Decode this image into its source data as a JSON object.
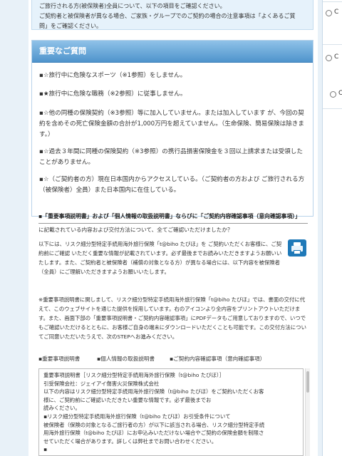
{
  "top_notice": {
    "lines": [
      "ご旅行される方(被保険者)全員について、以下の項目をご確認ください。",
      "ご契約者と被保険者が異なる場合、ご家族・グループでのご契約の場合の注意事項は「よくあるご質",
      "問」をご確認ください。"
    ]
  },
  "faq": {
    "title": "重要なご質問",
    "items": [
      "▪☆旅行中に危険なスポーツ（※1参照）をしません。",
      "▪★旅行中に危険な職務（※2参照）に従事しません。",
      "▪☆他の同種の保険契約（※3参照）等に加入していません。または加入しています が、今回の契約を含めその死亡保険金額の合計が1,000万円を超えていません。（生命保険、簡易保険は除きます。）",
      "▪☆過去３年間に同種の保険契約（※3参照）の携行品損害保険金を３回以上請求または受領したことがありません。",
      "▪☆（ご契約者の方）現在日本国内からアクセスしている。（ご契約者の方および ご旅行される方（被保険者）全員）また日本国内に在住している。"
    ]
  },
  "documents": {
    "heading": "▪「重要事項説明書」および「個人情報の取扱説明書」ならびに「ご契約内容確認事項（意向確認事項）」",
    "subheading": "に記載されている内容および交付方法について、全てご確認いただけましたか？",
    "paragraph1": "以下には、リスク細分型特定手続用海外旅行保険「t@biho たびほ」を ご契約いただくお客様に、ご契約前にご確認 いただく重要な情報が記載されています。必ず最後までお読みいただきますようお願いいたします。また、ご契約者と被保険者（補償の対象となる方）が異なる場合には、以下内容を被保険者（全員）にご理解いただきますようお願いいたします。",
    "paragraph2": "※重要事項説明書に関しまして、リスク細分型特定手続用海外旅行保険「t@biho たびほ」では、書面の交付に代えて、このウェブサイトを通じた提供を採用しています。右のアイコンより全内容をプリントアウトいただけます。また、画面下部の「重要事項説明書・ご契約内容確認事項」にPDFデータもご用意しておりますので、いつでもご確認いただけるとともに、お客様ご自身の端末にダウンロードいただくことも可能です。この交付方法についてご同意いただいたうえで、次のSTEPへお進みください。",
    "print_icon": "printer-icon",
    "links": [
      "▪重要事項説明書",
      "▪個人情報の取扱説明書",
      "▪ご契約内容確認事項（意向確認事項）"
    ],
    "scroll_text": [
      "重要事項説明書［リスク細分型特定手続用海外旅行保険（t@biho たびほ）］",
      "引受保険会社：ジェイアイ傷害火災保険株式会社",
      "以下の内容はリスク細分型特定手続用海外旅行保険（t@biho たびほ）をご契約いただくお客",
      "様に、ご契約前にご確認いただきたい重要な情報です。必ず最後までお",
      "読みください。",
      "▪リスク細分型特定手続用海外旅行保険（t@biho たびほ）お引受条件について",
      "被保険者（保険の対象となるご旅行者の方）が以下に該当される場合、リスク細分型特定手続",
      "用海外旅行保険（t@biho たびほ）にお申込みいただけない場合やご契約の保険金額を制限さ",
      "せていただく場合があります。詳しくは弊社までお問い合わせください。",
      "▪"
    ]
  },
  "right_panel": {
    "radio_marks": [
      "C",
      "C",
      "C"
    ]
  },
  "colors": {
    "header_blue": "#4f94cc",
    "notice_bg": "#e6f2fb",
    "page_bg": "#e8f1f8"
  }
}
